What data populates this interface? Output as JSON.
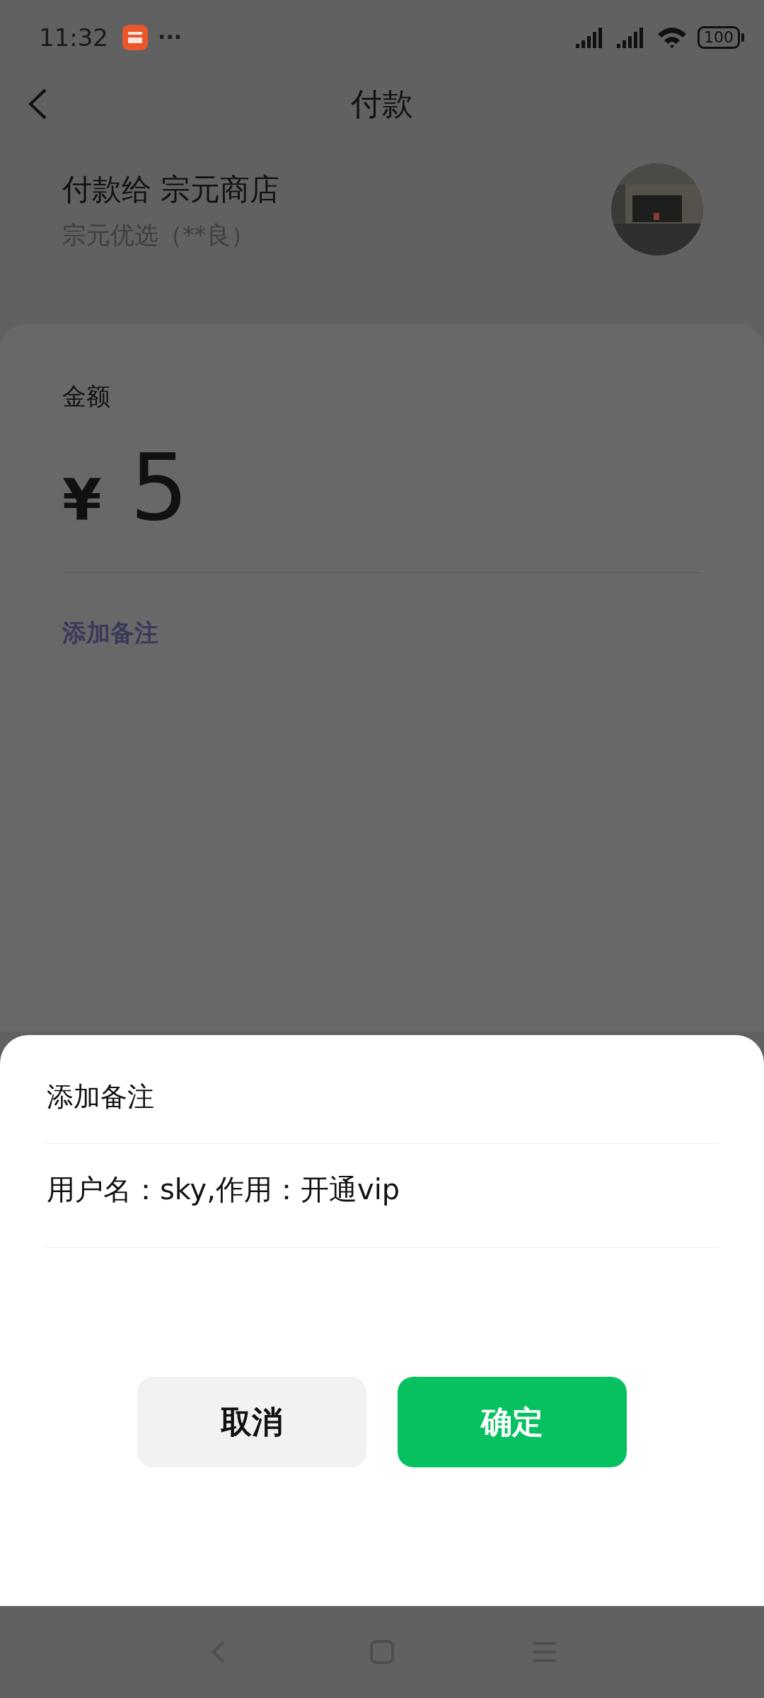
{
  "status_bar": {
    "time": "11:32",
    "more": "···",
    "battery": "100"
  },
  "header": {
    "title": "付款"
  },
  "payee": {
    "title": "付款给 宗元商店",
    "subtitle": "宗元优选（**良）"
  },
  "amount": {
    "label": "金额",
    "currency": "¥",
    "value": "5"
  },
  "note_link": "添加备注",
  "dialog": {
    "title": "添加备注",
    "value": "用户名：sky,作用：开通vip",
    "buttons": [
      {
        "label": "取消",
        "kind": "secondary"
      },
      {
        "label": "确定",
        "kind": "primary"
      }
    ]
  }
}
